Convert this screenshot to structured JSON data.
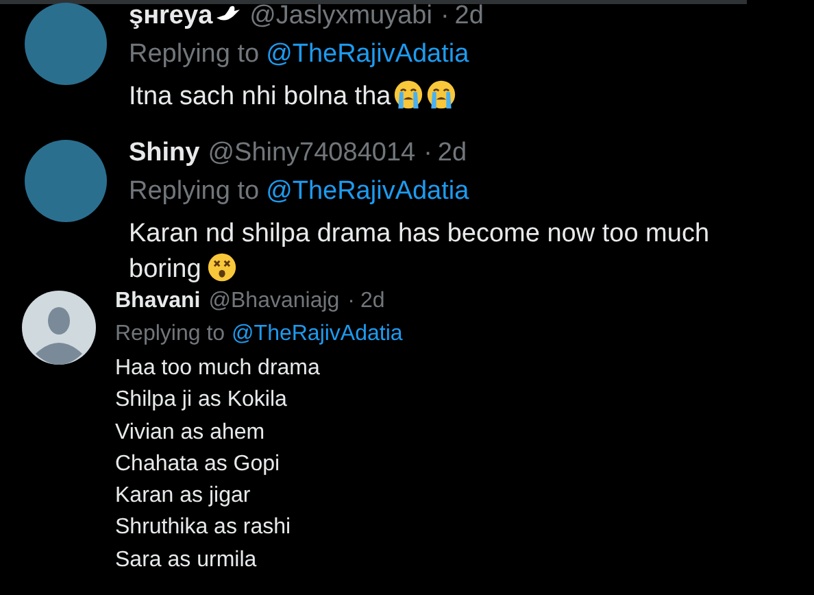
{
  "posts": [
    {
      "kind": "large",
      "name": "şнreya",
      "handle": "@Jaslyxmuyabi",
      "separator": "·",
      "time": "2d",
      "replying_label": "Replying to",
      "replying_to": "@TheRajivAdatia",
      "lines": [
        "Itna sach nhi bolna tha"
      ]
    },
    {
      "kind": "large",
      "name": "Shiny",
      "handle": "@Shiny74084014",
      "separator": "·",
      "time": "2d",
      "replying_label": "Replying to",
      "replying_to": "@TheRajivAdatia",
      "lines": [
        "Karan nd shilpa drama has become now too much",
        "boring"
      ]
    },
    {
      "kind": "compact",
      "name": "Bhavani",
      "handle": "@Bhavaniajg",
      "separator": "·",
      "time": "2d",
      "replying_label": "Replying to",
      "replying_to": "@TheRajivAdatia",
      "lines": [
        "Haa too much drama",
        "Shilpa ji as Kokila",
        "Vivian as ahem",
        "Chahata as Gopi",
        "Karan as jigar",
        "Shruthika as rashi",
        "Sara as urmila"
      ]
    }
  ]
}
